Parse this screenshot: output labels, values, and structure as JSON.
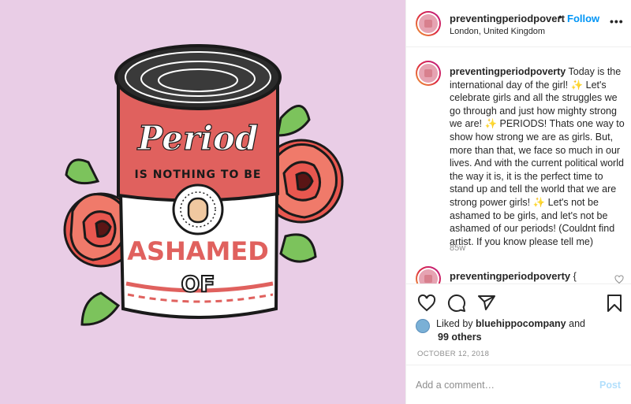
{
  "media": {
    "image_text": {
      "line1": "Period",
      "line2": "IS NOTHING TO BE",
      "line3": "ASHAMED",
      "line4": "OF"
    },
    "colors": {
      "background": "#e9cde6",
      "can_red": "#e0615e",
      "rose": "#e8574f",
      "leaf": "#7cc35c"
    }
  },
  "header": {
    "username": "preventingperiodpovert",
    "separator": "•",
    "follow_label": "Follow",
    "location": "London, United Kingdom",
    "more_icon": "more-horizontal-icon"
  },
  "caption": {
    "username": "preventingperiodpoverty",
    "parts": {
      "p1": "Today is the international day of the girl!",
      "s1": "✨",
      "p2": "Let's celebrate girls and all the struggles we go through and just how mighty strong we are!",
      "s2": "✨",
      "p3": "PERIODS! Thats one way to show how strong we are as girls. But, more than that, we face so much in our lives. And with the current political world the way it is, it is the perfect time to stand up and tell the world that we are strong power girls!",
      "s3": "✨",
      "p4": "Let's not be ashamed to be girls, and let's not be ashamed of our periods! (Couldnt find artist. If you know please tell me)"
    },
    "time_ago": "85w"
  },
  "reply": {
    "username": "preventingperiodpoverty",
    "text": "{"
  },
  "actions": {
    "icons": [
      "heart-icon",
      "comment-icon",
      "share-icon",
      "bookmark-icon"
    ]
  },
  "likes": {
    "prefix": "Liked by",
    "user": "bluehippocompany",
    "conj": "and",
    "others": "99 others"
  },
  "date": "OCTOBER 12, 2018",
  "comment_box": {
    "placeholder": "Add a comment…",
    "post_label": "Post"
  },
  "colors": {
    "accent": "#0095f6",
    "post_disabled": "#b2dffc",
    "text_secondary": "#8e8e8e"
  }
}
